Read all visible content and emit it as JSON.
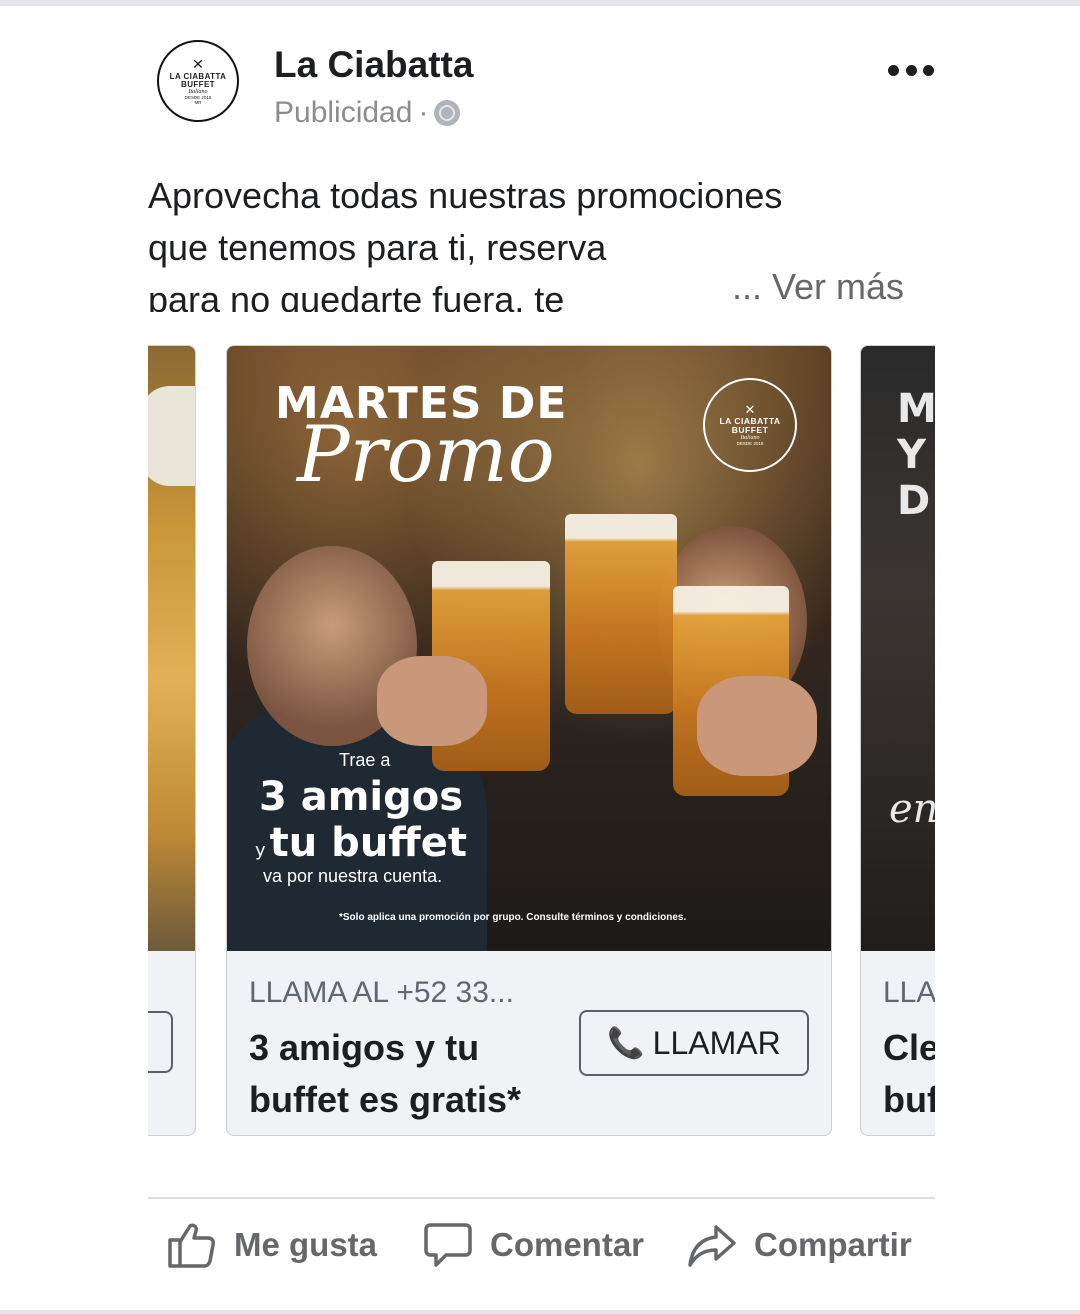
{
  "header": {
    "page_name": "La Ciabatta",
    "sponsored_label": "Publicidad",
    "separator": "·",
    "avatar": {
      "line1": "LA CIABATTA",
      "line2": "BUFFET",
      "line3": "Italiano",
      "line4": "DESDE 2018",
      "line5": "MR"
    }
  },
  "post": {
    "line1": "Aprovecha todas nuestras promociones",
    "line2": "que tenemos para ti, reserva",
    "line3": "para no quedarte fuera, te",
    "see_more": "... Ver más"
  },
  "carousel": {
    "main_card": {
      "image": {
        "title": "MARTES DE",
        "script": "Promo",
        "logo": {
          "a": "LA CIABATTA",
          "b": "BUFFET",
          "c": "Italiano",
          "d": "DESDE 2018"
        },
        "trae": "Trae a",
        "amigos": "3 amigos",
        "y": "y",
        "buffet": "tu buffet",
        "va": "va por nuestra cuenta.",
        "fine_print": "*Solo aplica una promoción por grupo. Consulte términos y condiciones."
      },
      "cta_top": "LLAMA AL +52 33...",
      "headline": "3 amigos y tu buffet es gratis*",
      "button_label": "LLAMAR"
    },
    "right_card": {
      "image_lines": [
        "M",
        "Y",
        "D"
      ],
      "image_script": "en",
      "cta_top": "LLA",
      "headline_line1": "Cle",
      "headline_line2": "buf"
    }
  },
  "actions": {
    "like": "Me gusta",
    "comment": "Comentar",
    "share": "Compartir"
  },
  "colors": {
    "text_primary": "#1c1e21",
    "text_secondary": "#65676b",
    "card_bg": "#f0f2f5",
    "border": "#ccd0d5"
  }
}
